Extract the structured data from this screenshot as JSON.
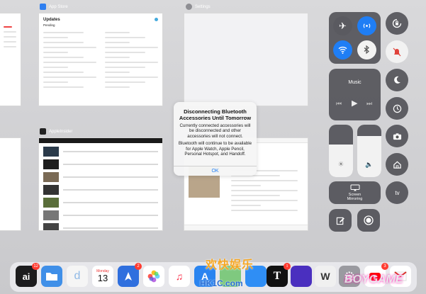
{
  "switcher": {
    "app_store_label": "App Store",
    "settings_label": "Settings",
    "appleinsider_label": "AppleInsider",
    "app_store_title": "Updates",
    "app_store_subtitle": "Pending"
  },
  "alert": {
    "title": "Disconnecting Bluetooth Accessories Until Tomorrow",
    "body1": "Currently connected accessories will be disconnected and other accessories will not connect.",
    "body2": "Bluetooth will continue to be available for Apple Watch, Apple Pencil, Personal Hotspot, and Handoff.",
    "ok": "OK"
  },
  "control_center": {
    "music_label": "Music",
    "screen_mirroring": "Screen Mirroring",
    "appletv_label": "tv"
  },
  "dock": {
    "icons": [
      {
        "name": "ai-app-icon",
        "label": "ai",
        "badge": "12",
        "color": "#1c1c1e"
      },
      {
        "name": "files-icon",
        "label": "",
        "badge": "",
        "color": "#3f8fe8"
      },
      {
        "name": "dict-icon",
        "label": "d",
        "badge": "",
        "color": "#f5f5f5"
      },
      {
        "name": "calendar-icon",
        "label": "13",
        "badge": "",
        "color": "#ffffff",
        "sub": "Monday"
      },
      {
        "name": "testflight-icon",
        "label": "",
        "badge": "2",
        "color": "#2f6fde"
      },
      {
        "name": "photos-icon",
        "label": "",
        "badge": "",
        "color": "#ffffff"
      },
      {
        "name": "nytimes-icon",
        "label": "T",
        "badge": "1",
        "color": "#111111"
      },
      {
        "name": "safari-icon",
        "label": "",
        "badge": "",
        "color": "#2a6fd6"
      },
      {
        "name": "youtube-icon",
        "label": "",
        "badge": "3",
        "color": "#ffffff"
      },
      {
        "name": "gmail-icon",
        "label": "",
        "badge": "",
        "color": "#ffffff"
      }
    ]
  },
  "watermark": {
    "site": "HK1C.com",
    "left_cn": "欢快娱乐",
    "right_text": "BOYGAME"
  },
  "colors": {
    "ios_blue": "#1f7ef5",
    "active_toggle": "#1f7ef5",
    "dnd_red": "#e0433b"
  }
}
